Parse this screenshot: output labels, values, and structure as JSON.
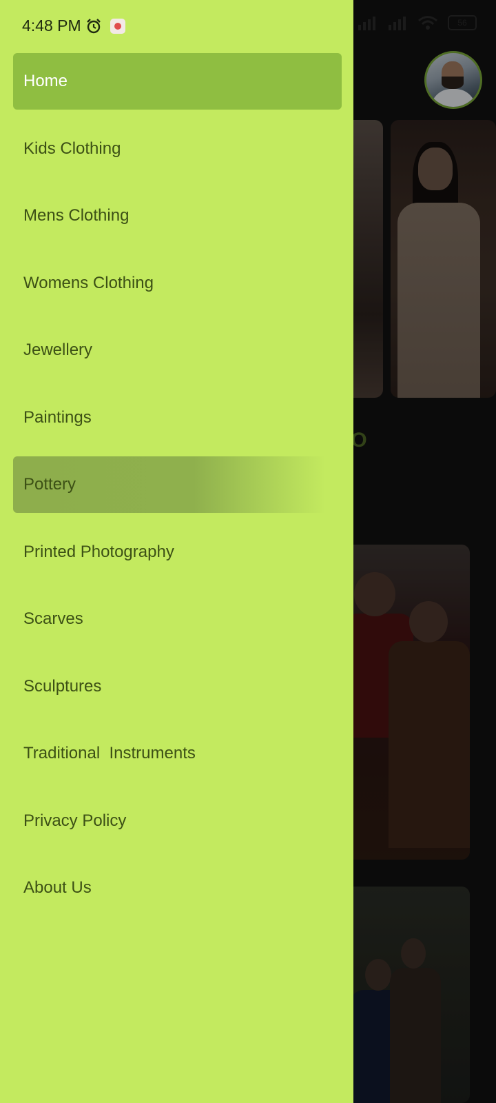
{
  "status_bar": {
    "time": "4:48 PM",
    "battery": "56"
  },
  "drawer": {
    "items": [
      {
        "label": "Home",
        "state": "selected"
      },
      {
        "label": "Kids Clothing"
      },
      {
        "label": "Mens Clothing"
      },
      {
        "label": "Womens Clothing"
      },
      {
        "label": "Jewellery"
      },
      {
        "label": "Paintings"
      },
      {
        "label": "Pottery",
        "state": "pressed"
      },
      {
        "label": "Printed Photography"
      },
      {
        "label": "Scarves"
      },
      {
        "label": "Sculptures"
      },
      {
        "label": "Traditional  Instruments"
      },
      {
        "label": "Privacy Policy"
      },
      {
        "label": "About Us"
      }
    ]
  },
  "background": {
    "section_title_fragment": "LO"
  },
  "colors": {
    "drawer_bg": "#c3ea5f",
    "selected_bg": "#8fbe41",
    "item_text": "#3c5015",
    "accent": "#7aa83a"
  },
  "icons": [
    "alarm-icon",
    "notification-icon",
    "signal-icon",
    "wifi-icon",
    "battery-icon",
    "chevron-down-icon"
  ]
}
